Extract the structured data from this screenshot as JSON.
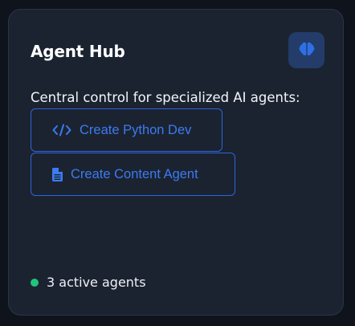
{
  "card": {
    "title": "Agent Hub",
    "description": "Central control for specialized AI agents:",
    "header_icon": "brain-icon"
  },
  "actions": [
    {
      "label": "Create Python Dev",
      "icon": "code-icon"
    },
    {
      "label": "Create Content Agent",
      "icon": "file-icon"
    }
  ],
  "status": {
    "text": "3 active agents",
    "indicator_color": "#21c37a"
  },
  "colors": {
    "accent": "#3c7bf0",
    "card_bg": "#1b2331",
    "page_bg": "#0e131c"
  }
}
